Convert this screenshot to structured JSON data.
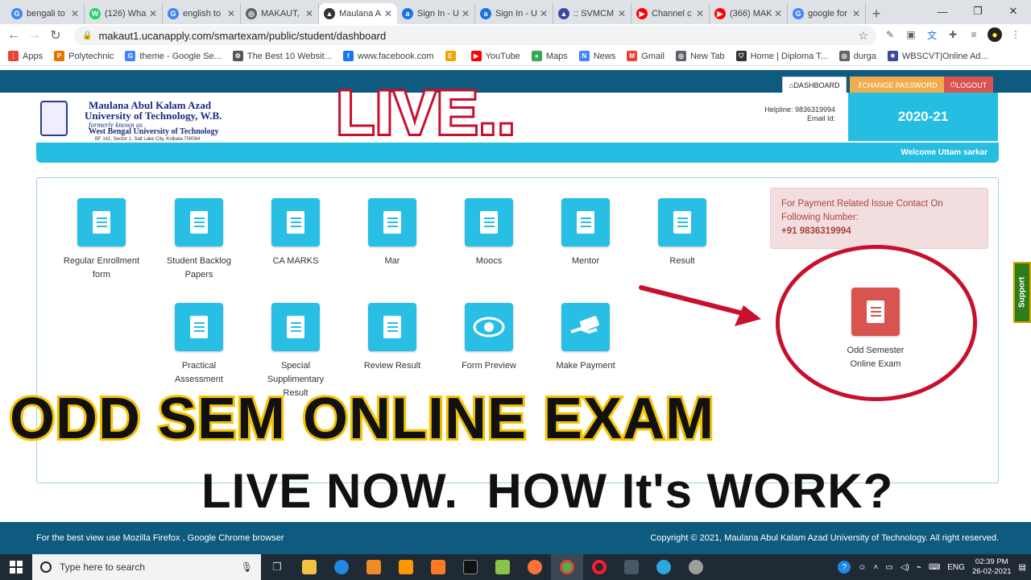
{
  "browser": {
    "tabs": [
      {
        "label": "bengali to",
        "icon": "google-icon",
        "color": "#4285f4",
        "glyph": "G"
      },
      {
        "label": "(126) Wha",
        "icon": "whatsapp-icon",
        "color": "#25d366",
        "glyph": "W"
      },
      {
        "label": "english to",
        "icon": "google-icon",
        "color": "#4285f4",
        "glyph": "G"
      },
      {
        "label": "MAKAUT,",
        "icon": "globe-icon",
        "color": "#5f6368",
        "glyph": "◎"
      },
      {
        "label": "Maulana A",
        "icon": "mortarboard-icon",
        "color": "#333333",
        "glyph": "▲",
        "active": true
      },
      {
        "label": "Sign In - U",
        "icon": "ucan-icon",
        "color": "#1a73e8",
        "glyph": "a"
      },
      {
        "label": "Sign In - U",
        "icon": "ucan-icon",
        "color": "#1a73e8",
        "glyph": "a"
      },
      {
        "label": ":: SVMCM",
        "icon": "cap-icon",
        "color": "#3b4aa0",
        "glyph": "▲"
      },
      {
        "label": "Channel c",
        "icon": "youtube-icon",
        "color": "#ff0000",
        "glyph": "▶"
      },
      {
        "label": "(366) MAK",
        "icon": "youtube-icon",
        "color": "#ff0000",
        "glyph": "▶"
      },
      {
        "label": "google for",
        "icon": "google-icon",
        "color": "#4285f4",
        "glyph": "G"
      }
    ],
    "url": "makaut1.ucanapply.com/smartexam/public/student/dashboard",
    "bookmarks": [
      {
        "label": "Apps",
        "icon": "apps-grid-icon",
        "color": "#ea4335",
        "glyph": "⋮"
      },
      {
        "label": "Polytechnic",
        "icon": "polytechnic-icon",
        "color": "#e37400",
        "glyph": "P"
      },
      {
        "label": "theme - Google Se...",
        "icon": "google-icon",
        "color": "#4285f4",
        "glyph": "G"
      },
      {
        "label": "The Best 10 Websit...",
        "icon": "gear-icon",
        "color": "#555555",
        "glyph": "⚙"
      },
      {
        "label": "www.facebook.com",
        "icon": "facebook-icon",
        "color": "#1877f2",
        "glyph": "f"
      },
      {
        "label": "",
        "icon": "ec-icon",
        "color": "#f4a300",
        "glyph": "E"
      },
      {
        "label": "YouTube",
        "icon": "youtube-icon",
        "color": "#ff0000",
        "glyph": "▶"
      },
      {
        "label": "Maps",
        "icon": "maps-icon",
        "color": "#34a853",
        "glyph": "●"
      },
      {
        "label": "News",
        "icon": "news-icon",
        "color": "#4285f4",
        "glyph": "N"
      },
      {
        "label": "Gmail",
        "icon": "gmail-icon",
        "color": "#ea4335",
        "glyph": "M"
      },
      {
        "label": "New Tab",
        "icon": "globe-icon",
        "color": "#5f6368",
        "glyph": "◎"
      },
      {
        "label": "Home | Diploma T...",
        "icon": "shield-icon",
        "color": "#333333",
        "glyph": "⛉"
      },
      {
        "label": "durga",
        "icon": "globe-icon",
        "color": "#5f6368",
        "glyph": "◎"
      },
      {
        "label": "WBSCVT|Online Ad...",
        "icon": "seal-icon",
        "color": "#3b4aa0",
        "glyph": "✷"
      }
    ]
  },
  "site": {
    "nav": {
      "dashboard": "DASHBOARD",
      "change_password": "CHANGE PASSWORD",
      "logout": "LOGOUT"
    },
    "logo": {
      "line1": "Maulana Abul Kalam Azad",
      "line2": "University of Technology, W.B.",
      "line3": "formerly known as",
      "line4": "West Bengal University of Technology",
      "line5": "BF 142, Sector 1, Salt Lake City, Kolkata-700064"
    },
    "helpline": "Helpline: 9836319994",
    "email": "Email Id:",
    "session": "2020-21",
    "welcome": "Welcome Uttam sarkar",
    "tiles_row1": [
      "Regular Enrollment form",
      "Student Backlog Papers",
      "CA MARKS",
      "Mar",
      "Moocs",
      "Mentor",
      "Result"
    ],
    "tiles_row2": [
      "Practical Assessment",
      "Special Supplimentary Result",
      "Review Result",
      "Form Preview",
      "Make Payment"
    ],
    "odd_sem_tile": "Odd Semester Online Exam",
    "payment": {
      "line1": "For Payment Related Issue Contact On",
      "line2": "Following Number:",
      "number": "+91 9836319994"
    },
    "support": "Support",
    "footer_left": "For the best view use Mozilla Firefox , Google Chrome browser",
    "footer_right": "Copyright © 2021, Maulana Abul Kalam Azad University of Technology. All right reserved."
  },
  "overlay": {
    "live": "LIVE..",
    "headline": "ODD SEM ONLINE EXAM",
    "subline": "LIVE NOW.  HOW It's WORK?",
    "accent_red": "#c8102e",
    "accent_yellow": "#f5c400"
  },
  "taskbar": {
    "search_placeholder": "Type here to search",
    "language": "ENG",
    "time": "02:39 PM",
    "date": "26-02-2021"
  }
}
